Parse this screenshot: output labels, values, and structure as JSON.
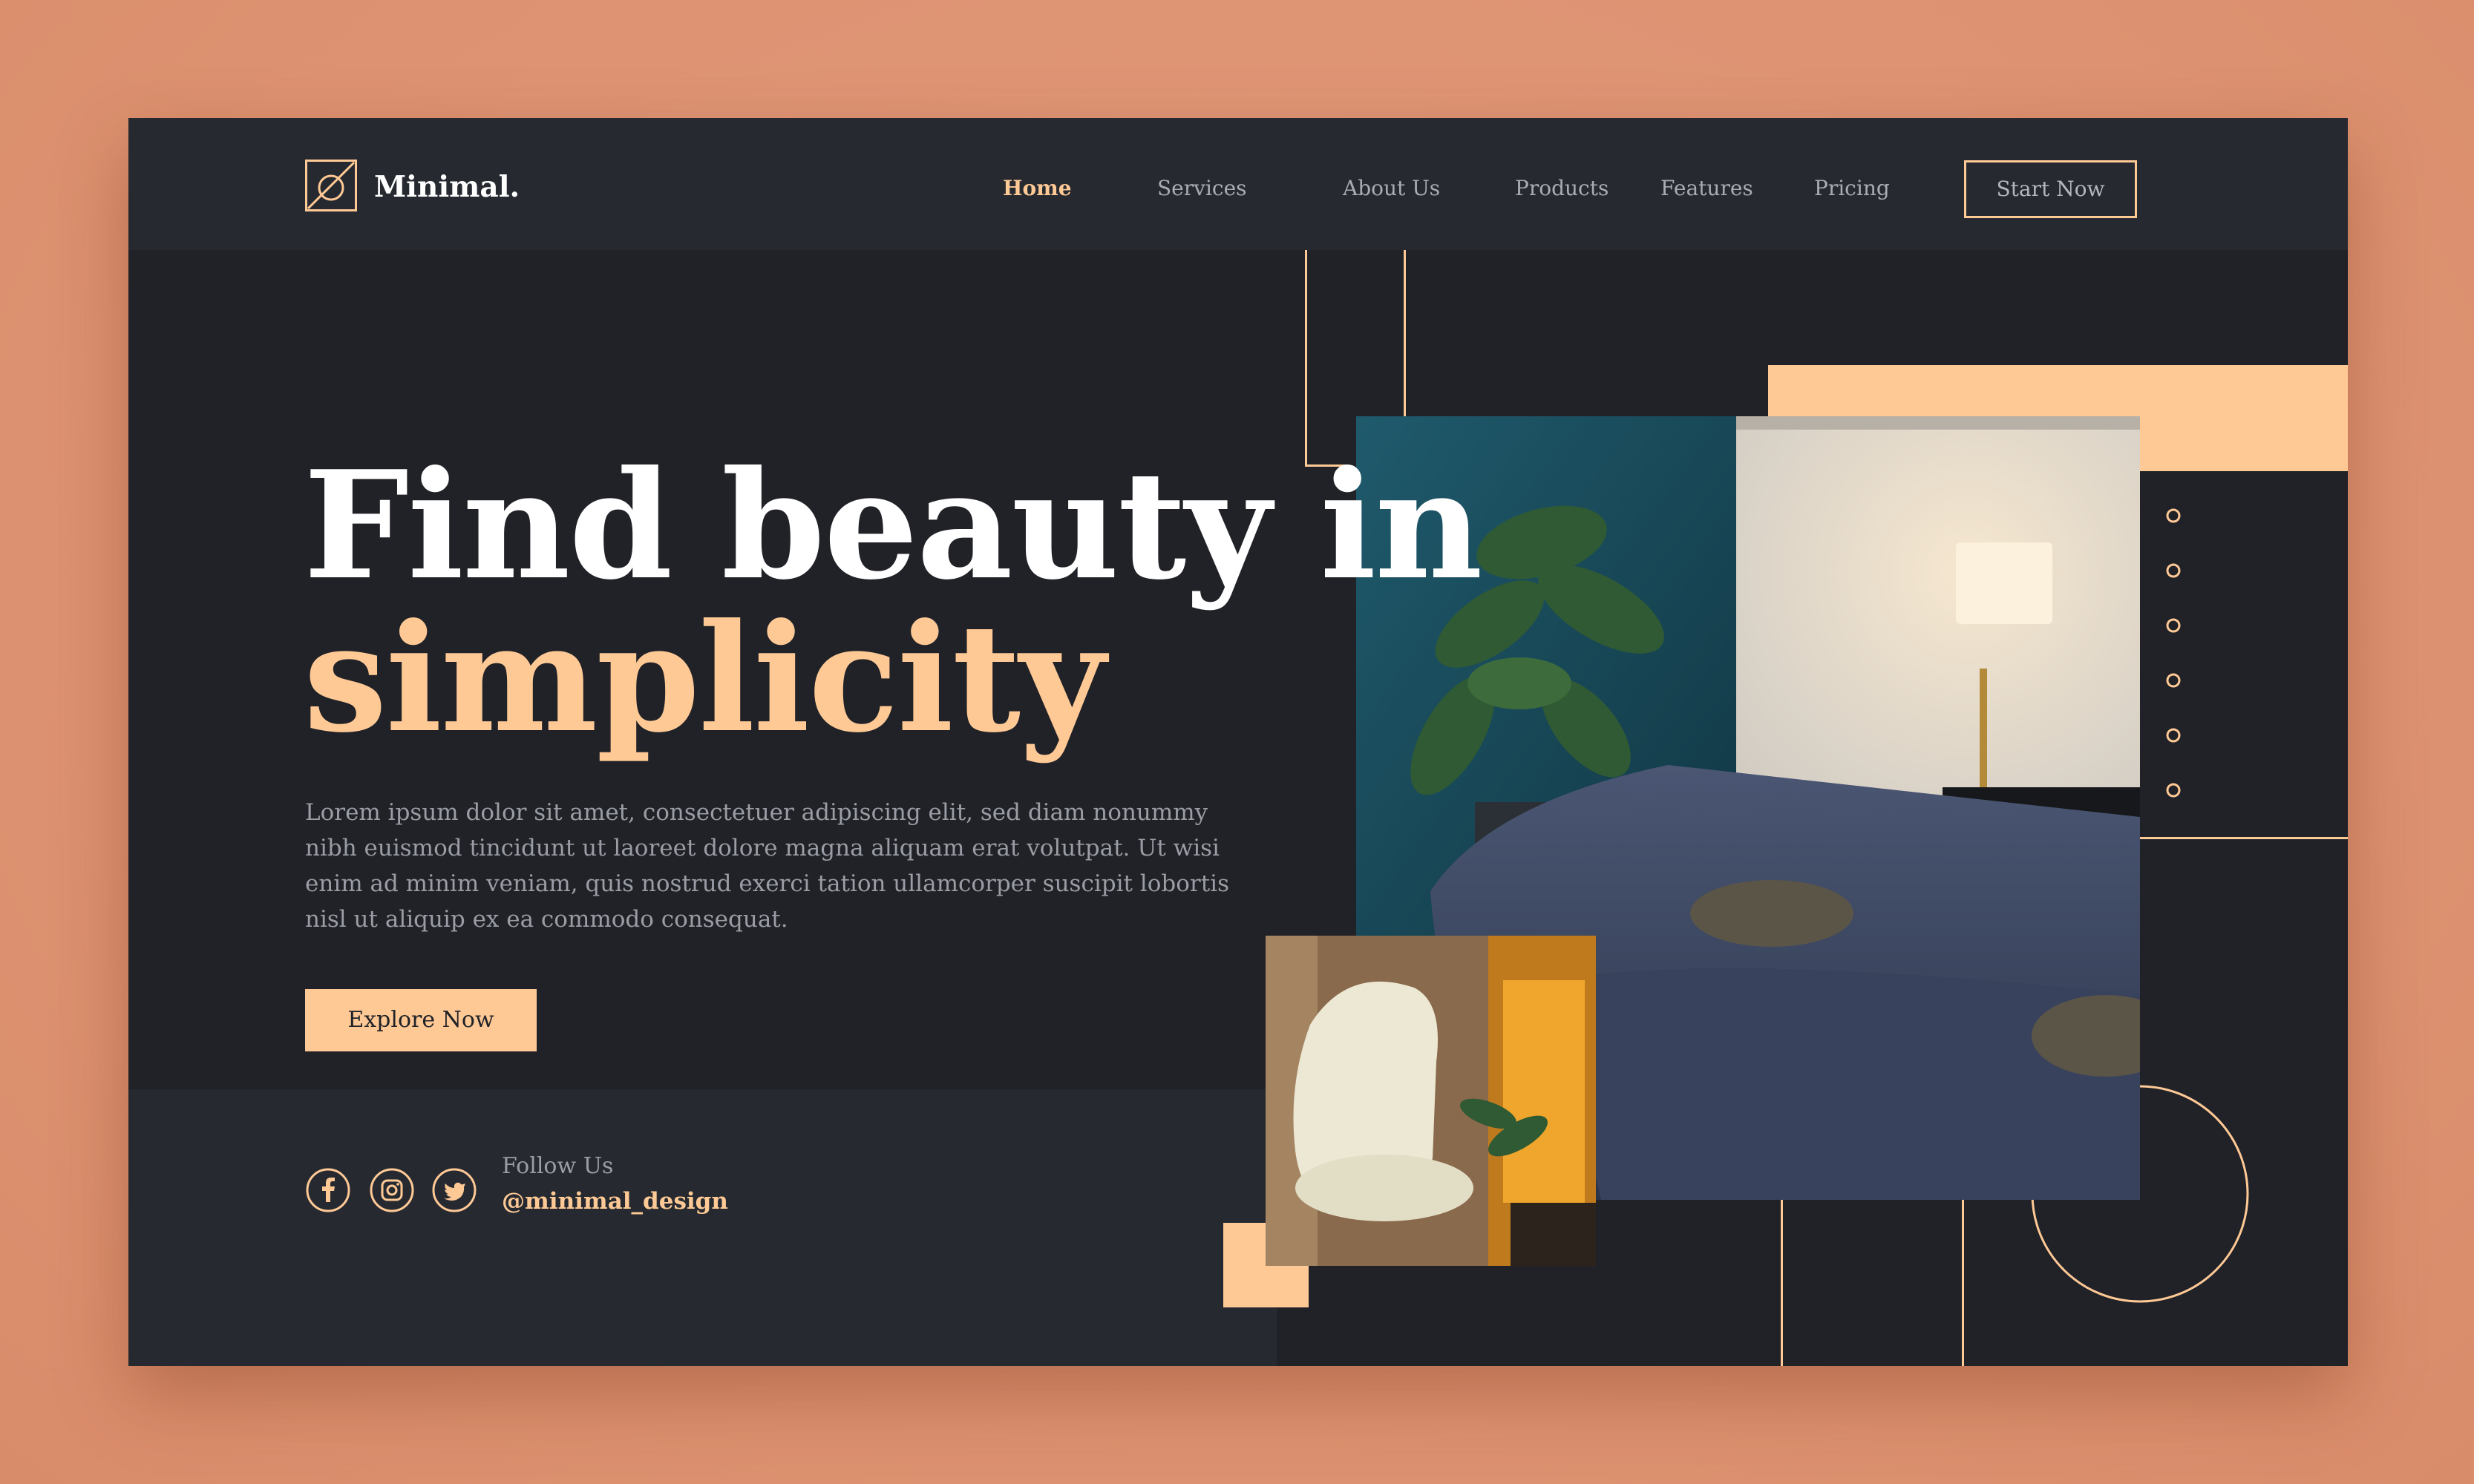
{
  "brand": {
    "name": "Minimal.",
    "logo_icon": "slashed-circle-square-icon"
  },
  "nav": {
    "items": [
      {
        "label": "Home",
        "active": true
      },
      {
        "label": "Services",
        "active": false
      },
      {
        "label": "About Us",
        "active": false
      },
      {
        "label": "Products",
        "active": false
      },
      {
        "label": "Features",
        "active": false
      },
      {
        "label": "Pricing",
        "active": false
      }
    ],
    "cta_label": "Start Now"
  },
  "hero": {
    "title_line1": "Find beauty in",
    "title_line2": "simplicity",
    "paragraph": "Lorem ipsum dolor sit amet, consectetuer adipiscing elit, sed diam nonummy nibh euismod tincidunt ut laoreet dolore magna aliquam erat volutpat. Ut wisi enim ad minim veniam, quis nostrud exerci tation ullamcorper suscipit lobortis nisl ut aliquip ex ea commodo consequat.",
    "button_label": "Explore Now"
  },
  "social": {
    "icons": [
      "facebook-icon",
      "instagram-icon",
      "twitter-icon"
    ],
    "follow_label": "Follow Us",
    "handle": "@minimal_design"
  },
  "colors": {
    "background": "#de9473",
    "panel": "#202227",
    "nav": "#262a30",
    "accent": "#ffc996",
    "text_muted": "#9a9da5",
    "text_light": "#ffffff"
  },
  "slider": {
    "dot_count": 6
  }
}
